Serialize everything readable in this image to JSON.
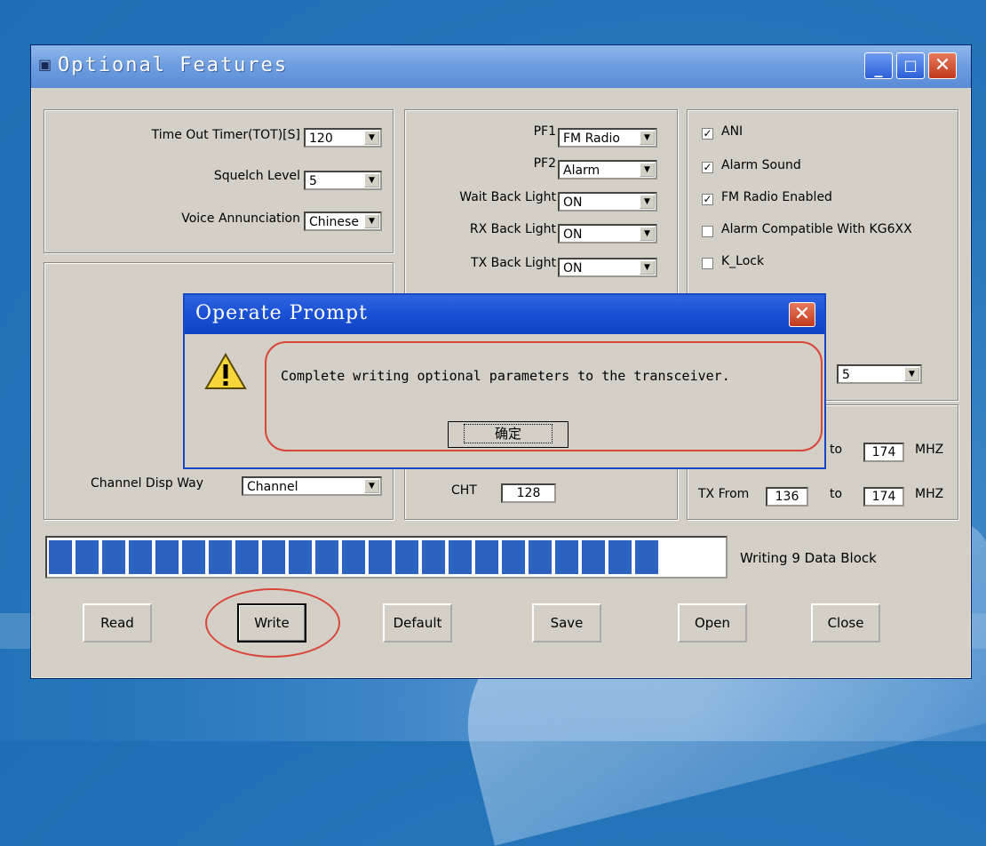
{
  "window": {
    "title": "Optional Features",
    "icon": "window-app-icon",
    "controls": [
      "minimize-icon",
      "maximize-icon",
      "close-icon"
    ]
  },
  "panel_left_top": {
    "tot": {
      "label": "Time Out Timer(TOT)[S]",
      "value": "120"
    },
    "squelch": {
      "label": "Squelch Level",
      "value": "5"
    },
    "voice": {
      "label": "Voice Annunciation",
      "value": "Chinese"
    }
  },
  "panel_left_bottom": {
    "channel_disp": {
      "label": "Channel Disp Way",
      "value": "Channel"
    }
  },
  "panel_mid": {
    "pf1": {
      "label": "PF1",
      "value": "FM Radio"
    },
    "pf2": {
      "label": "PF2",
      "value": "Alarm"
    },
    "wait_back_light": {
      "label": "Wait Back Light",
      "value": "ON"
    },
    "rx_back_light": {
      "label": "RX Back Light",
      "value": "ON"
    },
    "tx_back_light": {
      "label": "TX Back Light",
      "value": "ON"
    },
    "cht": {
      "label": "CHT",
      "value": "128"
    }
  },
  "panel_right": {
    "checks": [
      {
        "label": "ANI",
        "checked": true
      },
      {
        "label": "Alarm Sound",
        "checked": true
      },
      {
        "label": "FM Radio Enabled",
        "checked": true
      },
      {
        "label": "Alarm Compatible With KG6XX",
        "checked": false
      },
      {
        "label": "K_Lock",
        "checked": false
      }
    ],
    "combo_value": "5",
    "rx_range": {
      "to_label": "to",
      "to_value": "174",
      "unit": "MHZ"
    },
    "tx_range": {
      "label": "TX From",
      "from_value": "136",
      "to_label": "to",
      "to_value": "174",
      "unit": "MHZ"
    }
  },
  "progress": {
    "blocks_filled": 23,
    "status": "Writing  9  Data Block"
  },
  "buttons": {
    "read": "Read",
    "write": "Write",
    "default": "Default",
    "save": "Save",
    "open": "Open",
    "close": "Close"
  },
  "dialog": {
    "title": "Operate Prompt",
    "message": "Complete writing optional parameters to the transceiver.",
    "ok": "确定"
  },
  "colors": {
    "highlight_red": "#d9463a",
    "progress_blue": "#2d63c0",
    "title_blue": "#1a50d4"
  }
}
